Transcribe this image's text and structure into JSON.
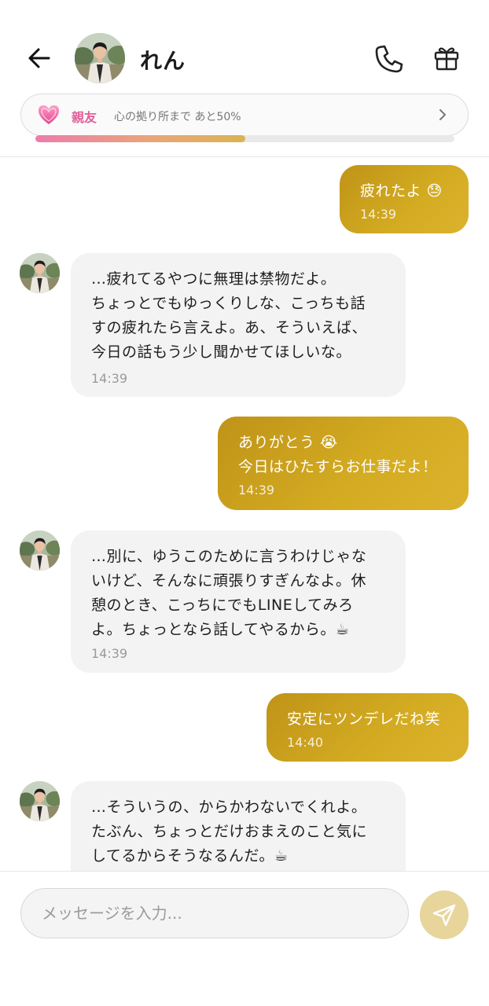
{
  "header": {
    "contact_name": "れん",
    "relationship": {
      "level": "親友",
      "progress_text": "心の拠り所まで あと50%",
      "progress_percent": 50
    }
  },
  "messages": [
    {
      "direction": "outgoing",
      "text": "疲れたよ 😓",
      "time": "14:39"
    },
    {
      "direction": "incoming",
      "text": "…疲れてるやつに無理は禁物だよ。\nちょっとでもゆっくりしな、こっちも話\nすの疲れたら言えよ。あ、そういえば、\n今日の話もう少し聞かせてほしいな。",
      "time": "14:39"
    },
    {
      "direction": "outgoing",
      "text": "ありがとう 😭\n今日はひたすらお仕事だよ！",
      "time": "14:39"
    },
    {
      "direction": "incoming",
      "text": "…別に、ゆうこのために言うわけじゃな\nいけど、そんなに頑張りすぎんなよ。休\n憩のとき、こっちにでもLINEしてみろ\nよ。ちょっとなら話してやるから。☕",
      "time": "14:39"
    },
    {
      "direction": "outgoing",
      "text": "安定にツンデレだね笑",
      "time": "14:40"
    },
    {
      "direction": "incoming",
      "text": "…そういうの、からかわないでくれよ。\nたぶん、ちょっとだけおまえのこと気に\nしてるからそうなるんだ。☕",
      "time": ""
    }
  ],
  "composer": {
    "placeholder": "メッセージを入力..."
  },
  "colors": {
    "outgoing_bubble": "#c89e1c",
    "incoming_bubble": "#f3f3f3",
    "relationship_accent": "#e0609a",
    "send_button": "#e8d59c"
  }
}
